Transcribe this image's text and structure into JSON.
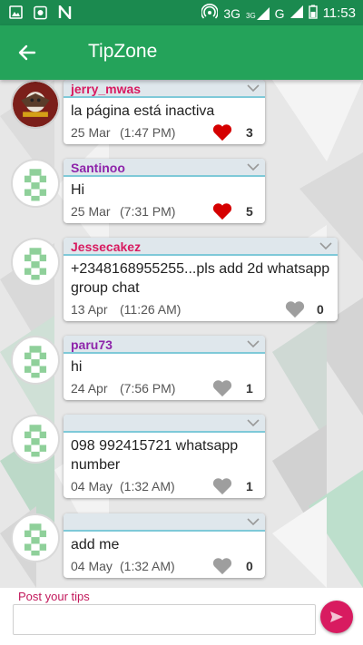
{
  "status_bar": {
    "network": "3G",
    "network_small": "3G",
    "signal_label": "G",
    "time": "11:53",
    "icons": [
      "image-icon",
      "camera-icon",
      "n-logo-icon",
      "hotspot-icon",
      "signal-icon",
      "battery-icon"
    ]
  },
  "app_bar": {
    "title": "TipZone",
    "back_icon": "arrow-back-icon"
  },
  "messages": [
    {
      "username": "jerry_mwas",
      "username_color": "#d81b60",
      "text": "la página está inactiva",
      "date": "25 Mar",
      "time": "(1:47 PM)",
      "likes": "3",
      "liked": true
    },
    {
      "username": "Santinoo",
      "username_color": "#8e24aa",
      "text": "Hi",
      "date": "25 Mar",
      "time": "(7:31 PM)",
      "likes": "5",
      "liked": true
    },
    {
      "username": "Jessecakez",
      "username_color": "#d81b60",
      "text": "+2348168955255...pls add 2d whatsapp group chat",
      "date": "13 Apr",
      "time": "(11:26 AM)",
      "likes": "0",
      "liked": false
    },
    {
      "username": "paru73",
      "username_color": "#8e24aa",
      "text": "hi",
      "date": "24 Apr",
      "time": "(7:56 PM)",
      "likes": "1",
      "liked": false
    },
    {
      "username": "",
      "username_color": "#8e24aa",
      "text": "098 992415721 whatsapp number",
      "date": "04 May",
      "time": "(1:32 AM)",
      "likes": "1",
      "liked": false
    },
    {
      "username": "",
      "username_color": "#8e24aa",
      "text": "add me",
      "date": "04 May",
      "time": "(1:32 AM)",
      "likes": "0",
      "liked": false
    }
  ],
  "composer": {
    "label": "Post your tips",
    "value": "",
    "placeholder": ""
  },
  "colors": {
    "status_bar": "#1b8a4f",
    "app_bar": "#24a35a",
    "heart_liked": "#d50000",
    "heart_unliked": "#9e9e9e",
    "send_button": "#d81b60"
  }
}
